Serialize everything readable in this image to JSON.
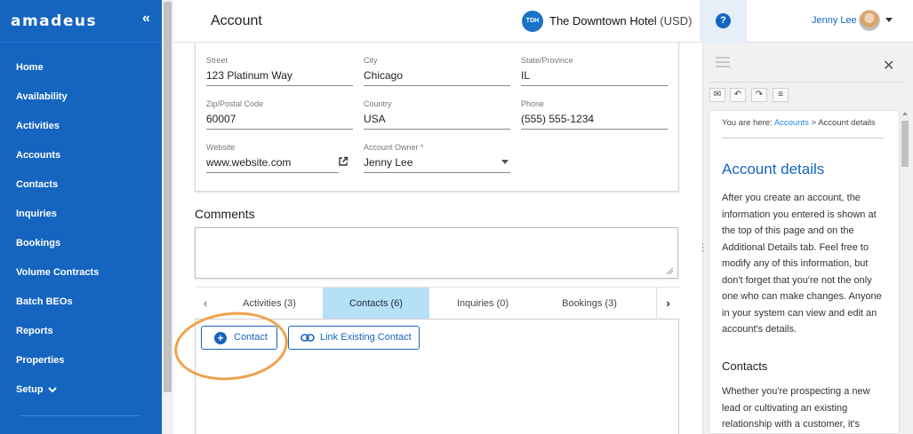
{
  "sidebar": {
    "logo": "amadeus",
    "collapse_icon": "«",
    "items": [
      {
        "label": "Home"
      },
      {
        "label": "Availability"
      },
      {
        "label": "Activities"
      },
      {
        "label": "Accounts"
      },
      {
        "label": "Contacts"
      },
      {
        "label": "Inquiries"
      },
      {
        "label": "Bookings"
      },
      {
        "label": "Volume Contracts"
      },
      {
        "label": "Batch BEOs"
      },
      {
        "label": "Reports"
      },
      {
        "label": "Properties"
      },
      {
        "label": "Setup"
      }
    ]
  },
  "header": {
    "title": "Account",
    "hotel_badge": "TDH",
    "hotel_name": "The Downtown Hotel",
    "currency": "(USD)",
    "help_icon": "?",
    "user_name": "Jenny Lee"
  },
  "form": {
    "street": {
      "label": "Street",
      "value": "123 Platinum Way"
    },
    "city": {
      "label": "City",
      "value": "Chicago"
    },
    "state": {
      "label": "State/Province",
      "value": "IL"
    },
    "zip": {
      "label": "Zip/Postal Code",
      "value": "60007"
    },
    "country": {
      "label": "Country",
      "value": "USA"
    },
    "phone": {
      "label": "Phone",
      "value": "(555) 555-1234"
    },
    "website": {
      "label": "Website",
      "value": "www.website.com"
    },
    "owner": {
      "label": "Account Owner *",
      "value": "Jenny Lee"
    }
  },
  "comments": {
    "title": "Comments",
    "value": ""
  },
  "tabs": {
    "prev": "‹",
    "next": "›",
    "items": [
      {
        "label": "Activities (3)"
      },
      {
        "label": "Contacts (6)",
        "active": true
      },
      {
        "label": "Inquiries (0)"
      },
      {
        "label": "Bookings (3)"
      }
    ]
  },
  "buttons": {
    "contact": "Contact",
    "link_existing": "Link Existing Contact"
  },
  "annotation_color": "#f0a24a",
  "help_panel": {
    "close": "✕",
    "crumb_prefix": "You are here: ",
    "crumb_link": "Accounts",
    "crumb_rest": " > Account details",
    "title": "Account details",
    "paragraph1": "After you create an account, the information you entered is shown at the top of this page and on the Additional Details tab. Feel free to modify any of this information, but don't forget that you're not the only one who can make changes. Anyone in your system can view and edit an account's details.",
    "subtitle": "Contacts",
    "paragraph2": "Whether you're prospecting a new lead or cultivating an existing relationship with a customer, it's"
  },
  "colors": {
    "brand": "#1565c0",
    "active_tab": "#b6e0f5"
  }
}
